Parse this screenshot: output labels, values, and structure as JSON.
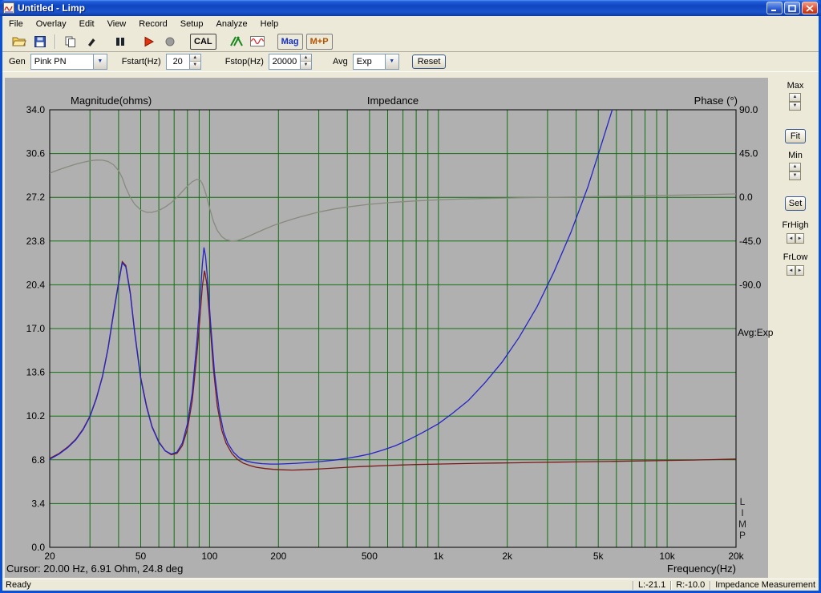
{
  "window": {
    "title": "Untitled - Limp"
  },
  "menu": {
    "items": [
      {
        "label": "File"
      },
      {
        "label": "Overlay"
      },
      {
        "label": "Edit"
      },
      {
        "label": "View"
      },
      {
        "label": "Record"
      },
      {
        "label": "Setup"
      },
      {
        "label": "Analyze"
      },
      {
        "label": "Help"
      }
    ]
  },
  "toolbar": {
    "icons": [
      "folder-open-icon",
      "floppy-save-icon",
      "copy-icon",
      "pen-icon",
      "pause-icon",
      "record-play-icon",
      "stop-icon",
      "green-hatch-icon",
      "sine-generator-icon"
    ],
    "cal_label": "CAL",
    "mag_label": "Mag",
    "mp_label": "M+P"
  },
  "controls": {
    "gen_label": "Gen",
    "gen_value": "Pink PN",
    "fstart_label": "Fstart(Hz)",
    "fstart_value": "20",
    "fstop_label": "Fstop(Hz)",
    "fstop_value": "20000",
    "avg_label": "Avg",
    "avg_value": "Exp",
    "reset_label": "Reset"
  },
  "side_panel": {
    "max_label": "Max",
    "fit_label": "Fit",
    "min_label": "Min",
    "set_label": "Set",
    "frhigh_label": "FrHigh",
    "frlow_label": "FrLow"
  },
  "chart": {
    "title": "Impedance",
    "left_axis_title": "Magnitude(ohms)",
    "right_axis_title": "Phase (°)",
    "x_axis_title": "Frequency(Hz)",
    "avg_indicator": "Avg:Exp",
    "limp_letters": [
      "L",
      "I",
      "M",
      "P"
    ],
    "cursor_text": "Cursor: 20.00 Hz, 6.91 Ohm, 24.8 deg"
  },
  "status_bar": {
    "ready": "Ready",
    "l_value": "L:-21.1",
    "r_value": "R:-10.0",
    "mode": "Impedance Measurement"
  },
  "chart_data": {
    "type": "line",
    "x_scale": "log",
    "x_range": [
      20,
      20000
    ],
    "grid_color": "#107010",
    "plot_bg": "#b0b0b0",
    "x_major_ticks": [
      "20",
      "50",
      "100",
      "200",
      "500",
      "1k",
      "2k",
      "5k",
      "10k",
      "20k"
    ],
    "x_major_tick_values": [
      20,
      50,
      100,
      200,
      500,
      1000,
      2000,
      5000,
      10000,
      20000
    ],
    "x_grid_values": [
      20,
      30,
      40,
      50,
      60,
      70,
      80,
      90,
      100,
      200,
      300,
      400,
      500,
      600,
      700,
      800,
      900,
      1000,
      2000,
      3000,
      4000,
      5000,
      6000,
      7000,
      8000,
      9000,
      10000,
      20000
    ],
    "mag_axis": {
      "min": 0,
      "max": 34,
      "ticks": [
        0,
        3.4,
        6.8,
        10.2,
        13.6,
        17.0,
        20.4,
        23.8,
        27.2,
        30.6,
        34.0
      ],
      "tick_labels": [
        "0.0",
        "3.4",
        "6.8",
        "10.2",
        "13.6",
        "17.0",
        "20.4",
        "23.8",
        "27.2",
        "30.6",
        "34.0"
      ]
    },
    "phase_axis": {
      "min": -90,
      "max": 90,
      "ticks": [
        90,
        45,
        0,
        -45,
        -90
      ],
      "tick_labels": [
        "90.0",
        "45.0",
        "0.0",
        "-45.0",
        "-90.0"
      ],
      "zero_at_mag": 27.2,
      "deg_per_div": 45,
      "mag_per_div": 3.4
    },
    "series": [
      {
        "name": "phase",
        "axis": "phase",
        "color": "#878b7d",
        "points": [
          [
            20,
            24.8
          ],
          [
            22,
            28.5
          ],
          [
            24,
            31.5
          ],
          [
            26,
            34
          ],
          [
            28,
            36
          ],
          [
            30,
            37.5
          ],
          [
            32,
            38.3
          ],
          [
            34,
            38.2
          ],
          [
            36,
            36.8
          ],
          [
            38,
            33.5
          ],
          [
            40,
            27.5
          ],
          [
            41.5,
            20
          ],
          [
            43,
            10
          ],
          [
            45,
            0
          ],
          [
            47,
            -7
          ],
          [
            50,
            -13
          ],
          [
            53,
            -15.5
          ],
          [
            56,
            -15.5
          ],
          [
            60,
            -13.5
          ],
          [
            64,
            -10
          ],
          [
            68,
            -5.5
          ],
          [
            72,
            0
          ],
          [
            76,
            6
          ],
          [
            80,
            11.5
          ],
          [
            84,
            16
          ],
          [
            88,
            18.5
          ],
          [
            91,
            17.5
          ],
          [
            93,
            14
          ],
          [
            95,
            8
          ],
          [
            97,
            1
          ],
          [
            100,
            -11
          ],
          [
            104,
            -25
          ],
          [
            108,
            -34
          ],
          [
            113,
            -40.5
          ],
          [
            118,
            -43.5
          ],
          [
            125,
            -45
          ],
          [
            132,
            -44.5
          ],
          [
            140,
            -42.5
          ],
          [
            150,
            -39.5
          ],
          [
            160,
            -36.5
          ],
          [
            175,
            -32.5
          ],
          [
            190,
            -29
          ],
          [
            210,
            -25.5
          ],
          [
            230,
            -22.5
          ],
          [
            250,
            -20
          ],
          [
            280,
            -17
          ],
          [
            310,
            -14.5
          ],
          [
            350,
            -12
          ],
          [
            400,
            -10
          ],
          [
            450,
            -8.5
          ],
          [
            500,
            -7.2
          ],
          [
            600,
            -5.6
          ],
          [
            700,
            -4.5
          ],
          [
            800,
            -3.7
          ],
          [
            1000,
            -2.6
          ],
          [
            1200,
            -1.9
          ],
          [
            1500,
            -1.3
          ],
          [
            1800,
            -0.9
          ],
          [
            2200,
            -0.5
          ],
          [
            2700,
            -0.2
          ],
          [
            3300,
            0.1
          ],
          [
            4000,
            0.4
          ],
          [
            5000,
            0.8
          ],
          [
            6000,
            1.1
          ],
          [
            8000,
            1.6
          ],
          [
            10000,
            2.0
          ],
          [
            13000,
            2.5
          ],
          [
            16000,
            3.0
          ],
          [
            20000,
            3.5
          ]
        ]
      },
      {
        "name": "impedance-magnitude-overlay",
        "axis": "mag",
        "color": "#7a1a1a",
        "points": [
          [
            20,
            6.91
          ],
          [
            22,
            7.3
          ],
          [
            24,
            7.8
          ],
          [
            26,
            8.4
          ],
          [
            28,
            9.2
          ],
          [
            30,
            10.2
          ],
          [
            32,
            11.6
          ],
          [
            34,
            13.3
          ],
          [
            36,
            15.5
          ],
          [
            38,
            18.2
          ],
          [
            40,
            20.6
          ],
          [
            41.5,
            22.2
          ],
          [
            43,
            21.9
          ],
          [
            45,
            19.8
          ],
          [
            47,
            16.8
          ],
          [
            50,
            13.2
          ],
          [
            53,
            11.0
          ],
          [
            56,
            9.4
          ],
          [
            60,
            8.2
          ],
          [
            64,
            7.5
          ],
          [
            68,
            7.2
          ],
          [
            72,
            7.3
          ],
          [
            76,
            7.9
          ],
          [
            80,
            9.2
          ],
          [
            84,
            11.4
          ],
          [
            88,
            15.0
          ],
          [
            91,
            18.2
          ],
          [
            93,
            20.3
          ],
          [
            95,
            21.5
          ],
          [
            97,
            20.6
          ],
          [
            100,
            17.8
          ],
          [
            104,
            13.8
          ],
          [
            108,
            11.0
          ],
          [
            113,
            9.1
          ],
          [
            118,
            8.1
          ],
          [
            125,
            7.3
          ],
          [
            132,
            6.85
          ],
          [
            140,
            6.55
          ],
          [
            150,
            6.35
          ],
          [
            160,
            6.22
          ],
          [
            175,
            6.12
          ],
          [
            190,
            6.06
          ],
          [
            210,
            6.02
          ],
          [
            230,
            6.0
          ],
          [
            250,
            6.02
          ],
          [
            280,
            6.06
          ],
          [
            310,
            6.1
          ],
          [
            350,
            6.16
          ],
          [
            400,
            6.22
          ],
          [
            450,
            6.27
          ],
          [
            500,
            6.3
          ],
          [
            600,
            6.36
          ],
          [
            700,
            6.4
          ],
          [
            800,
            6.43
          ],
          [
            1000,
            6.47
          ],
          [
            1200,
            6.5
          ],
          [
            1500,
            6.53
          ],
          [
            1800,
            6.55
          ],
          [
            2200,
            6.57
          ],
          [
            2700,
            6.6
          ],
          [
            3300,
            6.62
          ],
          [
            4000,
            6.64
          ],
          [
            5000,
            6.66
          ],
          [
            6000,
            6.68
          ],
          [
            8000,
            6.72
          ],
          [
            10000,
            6.75
          ],
          [
            13000,
            6.78
          ],
          [
            16000,
            6.82
          ],
          [
            20000,
            6.86
          ]
        ]
      },
      {
        "name": "impedance-magnitude",
        "axis": "mag",
        "color": "#2424c8",
        "points": [
          [
            20,
            6.85
          ],
          [
            22,
            7.25
          ],
          [
            24,
            7.75
          ],
          [
            26,
            8.35
          ],
          [
            28,
            9.15
          ],
          [
            30,
            10.15
          ],
          [
            32,
            11.55
          ],
          [
            34,
            13.25
          ],
          [
            36,
            15.45
          ],
          [
            38,
            18.1
          ],
          [
            40,
            20.5
          ],
          [
            41.5,
            22.1
          ],
          [
            43,
            21.8
          ],
          [
            45,
            19.7
          ],
          [
            47,
            16.7
          ],
          [
            50,
            13.1
          ],
          [
            53,
            10.9
          ],
          [
            56,
            9.35
          ],
          [
            60,
            8.15
          ],
          [
            64,
            7.5
          ],
          [
            68,
            7.25
          ],
          [
            72,
            7.4
          ],
          [
            76,
            8.1
          ],
          [
            80,
            9.6
          ],
          [
            84,
            12.0
          ],
          [
            88,
            16.0
          ],
          [
            91,
            19.6
          ],
          [
            93,
            22.0
          ],
          [
            94.5,
            23.3
          ],
          [
            96,
            22.6
          ],
          [
            98,
            20.8
          ],
          [
            101,
            17.4
          ],
          [
            105,
            13.6
          ],
          [
            110,
            10.7
          ],
          [
            115,
            9.0
          ],
          [
            120,
            8.1
          ],
          [
            127,
            7.4
          ],
          [
            135,
            6.95
          ],
          [
            145,
            6.7
          ],
          [
            155,
            6.58
          ],
          [
            170,
            6.5
          ],
          [
            185,
            6.47
          ],
          [
            200,
            6.47
          ],
          [
            220,
            6.5
          ],
          [
            240,
            6.53
          ],
          [
            260,
            6.57
          ],
          [
            290,
            6.63
          ],
          [
            320,
            6.7
          ],
          [
            360,
            6.8
          ],
          [
            400,
            6.92
          ],
          [
            450,
            7.08
          ],
          [
            500,
            7.25
          ],
          [
            570,
            7.55
          ],
          [
            650,
            7.9
          ],
          [
            750,
            8.4
          ],
          [
            850,
            8.9
          ],
          [
            1000,
            9.6
          ],
          [
            1150,
            10.4
          ],
          [
            1350,
            11.4
          ],
          [
            1600,
            12.8
          ],
          [
            1900,
            14.4
          ],
          [
            2250,
            16.3
          ],
          [
            2700,
            18.7
          ],
          [
            3200,
            21.4
          ],
          [
            3800,
            24.5
          ],
          [
            4500,
            28.0
          ],
          [
            5200,
            31.5
          ],
          [
            5800,
            34.2
          ],
          [
            6000,
            35.5
          ]
        ]
      }
    ]
  }
}
